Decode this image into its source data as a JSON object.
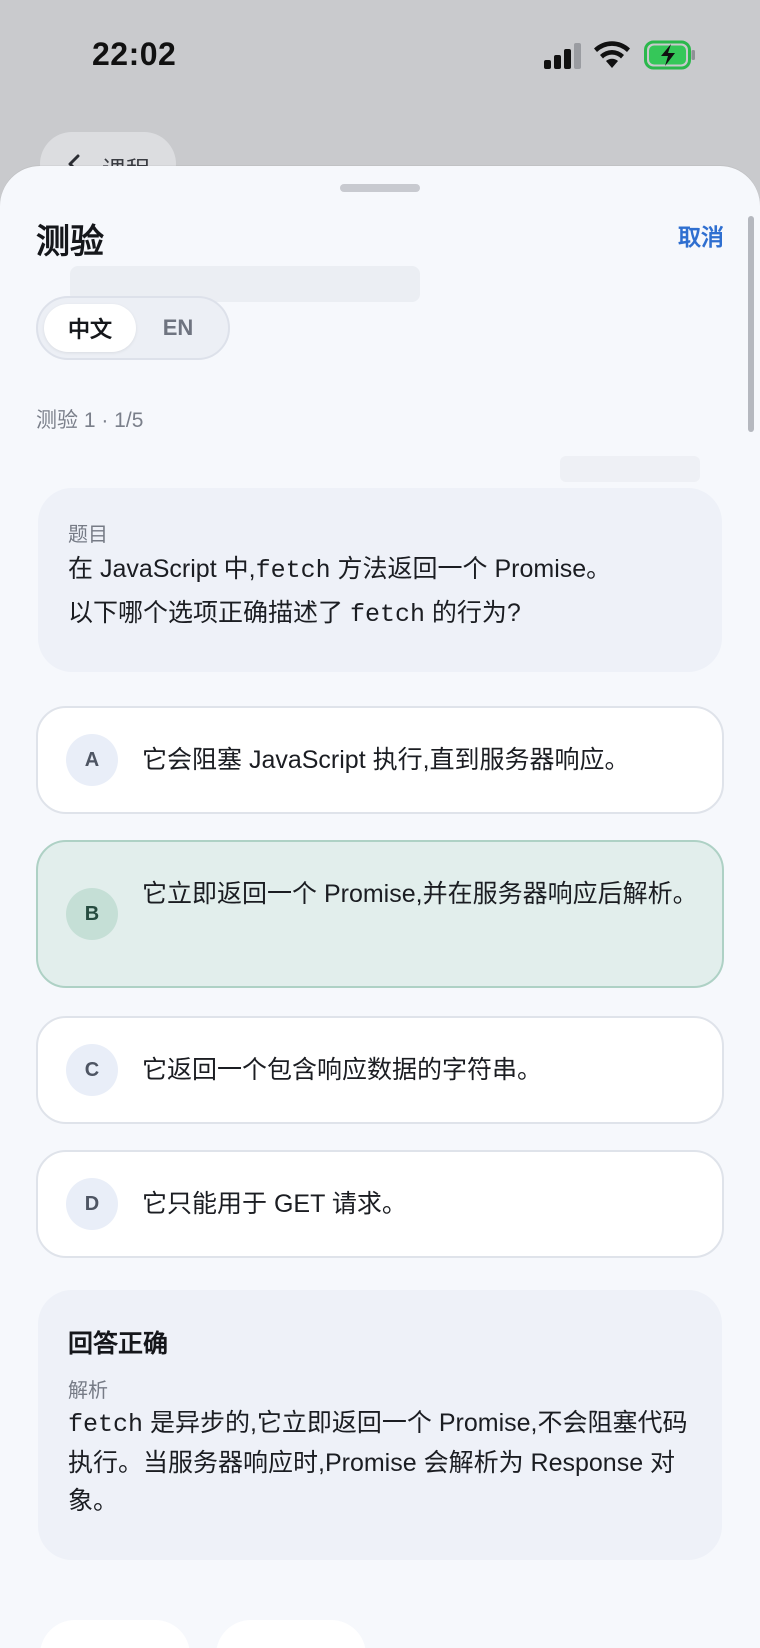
{
  "status_bar": {
    "time": "22:02"
  },
  "background_page": {
    "back_label": "课程"
  },
  "sheet": {
    "title": "测验",
    "cancel_label": "取消"
  },
  "language_toggle": {
    "zh_label": "中文",
    "en_label": "EN",
    "selected": "中文"
  },
  "progress": "测验 1 · 1/5",
  "question": {
    "label": "题目",
    "line1_pre": "在 JavaScript 中,",
    "line1_code": "fetch",
    "line1_post": " 方法返回一个 Promise。",
    "line2_pre": "以下哪个选项正确描述了 ",
    "line2_code": "fetch",
    "line2_post": " 的行为?"
  },
  "options": [
    {
      "letter": "A",
      "text": "它会阻塞 JavaScript 执行,直到服务器响应。"
    },
    {
      "letter": "B",
      "text": "它立即返回一个 Promise,并在服务器响应后解析。",
      "selected": true
    },
    {
      "letter": "C",
      "text": "它返回一个包含响应数据的字符串。"
    },
    {
      "letter": "D",
      "text": "它只能用于 GET 请求。"
    }
  ],
  "result": {
    "title": "回答正确",
    "explanation_label": "解析",
    "explanation_code": "fetch",
    "explanation_text": " 是异步的,它立即返回一个 Promise,不会阻塞代码执行。当服务器响应时,Promise 会解析为 Response 对象。"
  },
  "colors": {
    "accent": "#2f6fd0",
    "selected_bg": "#e2eeec",
    "selected_border": "#aed1c5"
  }
}
